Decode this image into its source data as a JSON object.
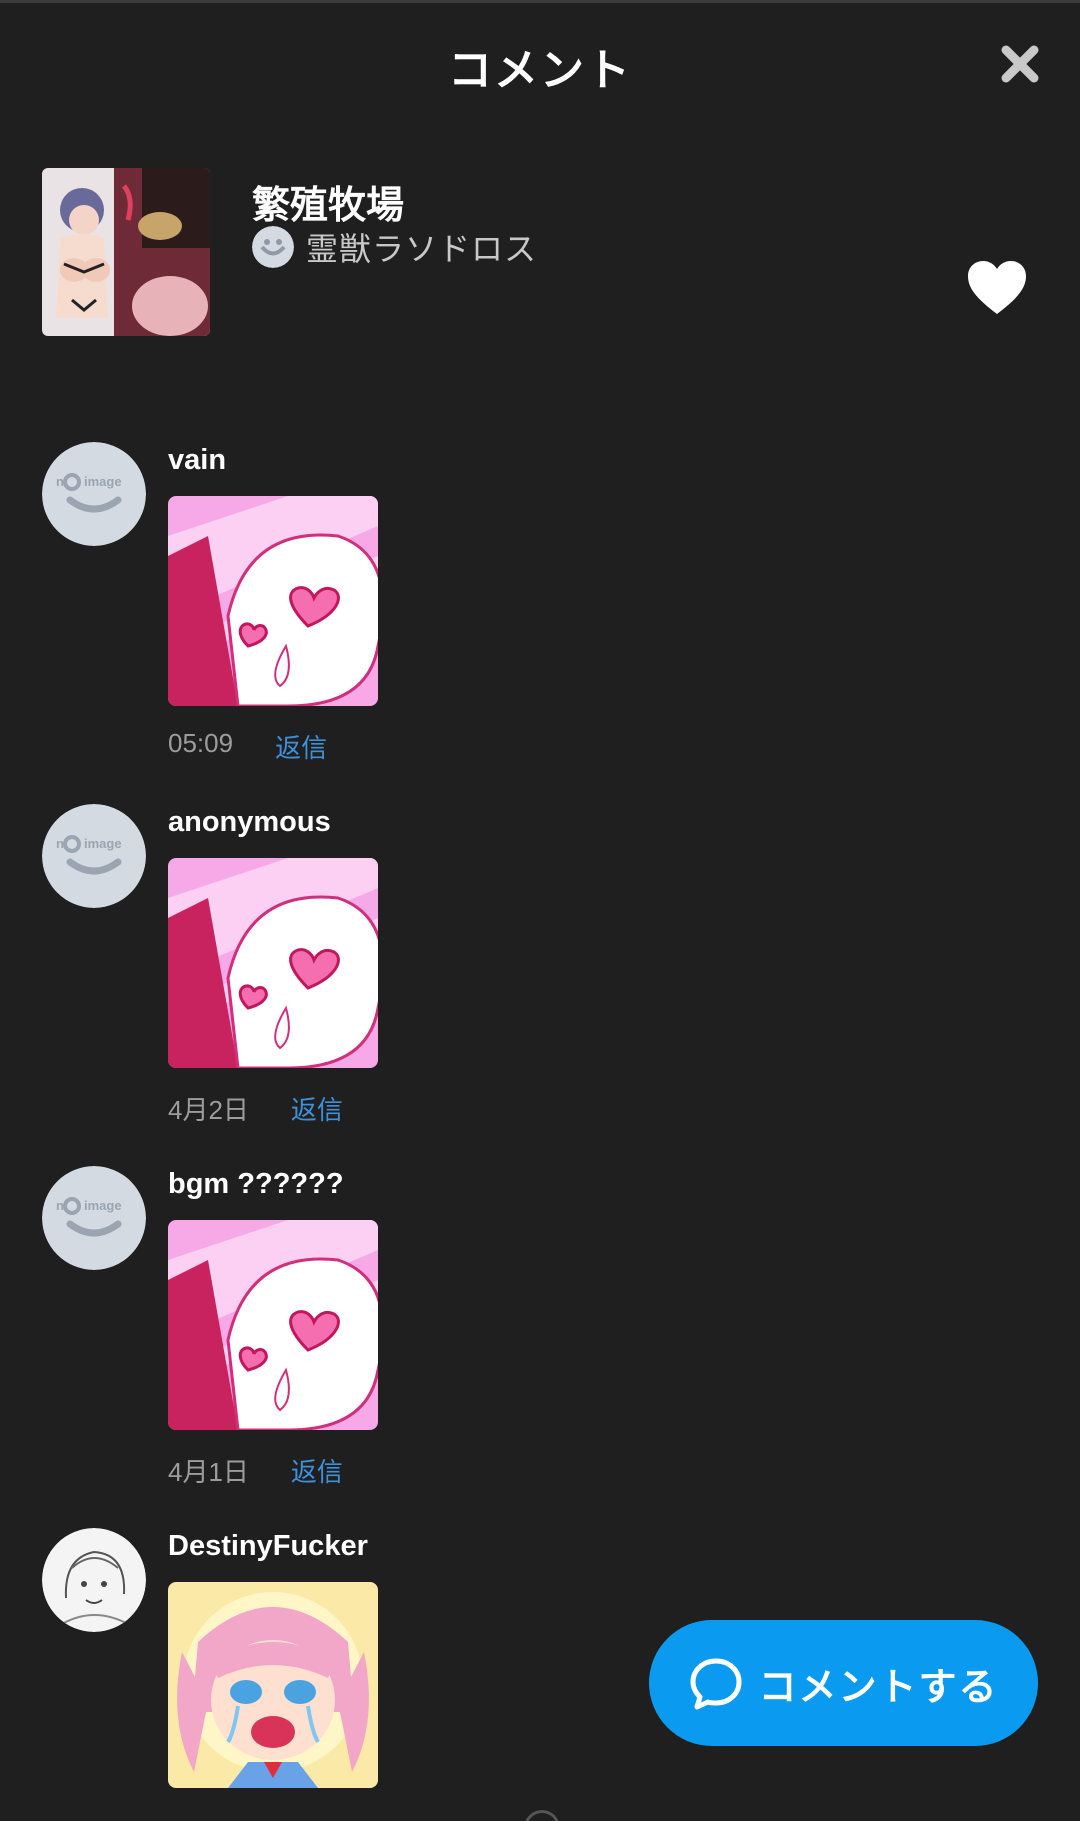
{
  "header": {
    "title": "コメント"
  },
  "work": {
    "title": "繁殖牧場",
    "author": "霊獣ラソドロス"
  },
  "avatar_placeholder": {
    "text_n": "n",
    "text_image": "image"
  },
  "comments": [
    {
      "user": "vain",
      "date": "05:09",
      "reply_label": "返信",
      "avatar": "no-image",
      "image": "heart-eyes-sticker"
    },
    {
      "user": "anonymous",
      "date": "4月2日",
      "reply_label": "返信",
      "avatar": "no-image",
      "image": "heart-eyes-sticker"
    },
    {
      "user": "bgm ??????",
      "date": "4月1日",
      "reply_label": "返信",
      "avatar": "no-image",
      "image": "heart-eyes-sticker"
    },
    {
      "user": "DestinyFucker",
      "date": "",
      "reply_label": "",
      "avatar": "sketch-portrait",
      "image": "crying-anime-girl"
    }
  ],
  "fab": {
    "label": "コメントする"
  },
  "colors": {
    "background": "#1f1f1f",
    "accent": "#0a9bf0",
    "reply": "#3e90d8",
    "muted": "#9c9c9c"
  },
  "icons": {
    "close": "close-icon",
    "favorite": "heart-icon",
    "fab": "speech-bubble-icon"
  }
}
